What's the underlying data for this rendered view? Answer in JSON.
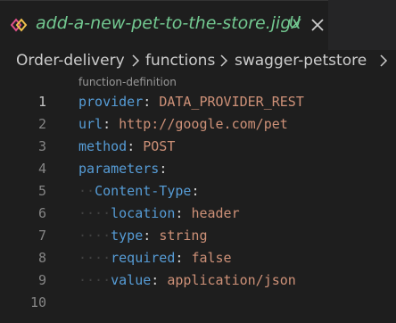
{
  "tab": {
    "filename": "add-a-new-pet-to-the-store.jigx",
    "status_badge": "U",
    "icon": "jigx-diamond-icon",
    "close_icon": "close-icon"
  },
  "breadcrumb": {
    "items": [
      "Order-delivery",
      "functions",
      "swagger-petstore"
    ],
    "separator_icon": "chevron-right-icon"
  },
  "codelens": "function-definition",
  "lines": [
    {
      "num": "1",
      "indent": "",
      "key": "provider",
      "colon": ": ",
      "value": "DATA_PROVIDER_REST"
    },
    {
      "num": "2",
      "indent": "",
      "key": "url",
      "colon": ": ",
      "value": "http://google.com/pet"
    },
    {
      "num": "3",
      "indent": "",
      "key": "method",
      "colon": ": ",
      "value": "POST"
    },
    {
      "num": "4",
      "indent": "",
      "key": "parameters",
      "colon": ":",
      "value": ""
    },
    {
      "num": "5",
      "indent": "··",
      "key": "Content-Type",
      "colon": ":",
      "value": ""
    },
    {
      "num": "6",
      "indent": "····",
      "key": "location",
      "colon": ": ",
      "value": "header"
    },
    {
      "num": "7",
      "indent": "····",
      "key": "type",
      "colon": ": ",
      "value": "string"
    },
    {
      "num": "8",
      "indent": "····",
      "key": "required",
      "colon": ": ",
      "value": "false"
    },
    {
      "num": "9",
      "indent": "····",
      "key": "value",
      "colon": ": ",
      "value": "application/json"
    },
    {
      "num": "10",
      "indent": "",
      "key": "",
      "colon": "",
      "value": ""
    }
  ],
  "colors": {
    "editor_bg": "#1e1e1e",
    "key": "#569cd6",
    "string_value": "#ce9178",
    "untracked": "#73c991"
  }
}
